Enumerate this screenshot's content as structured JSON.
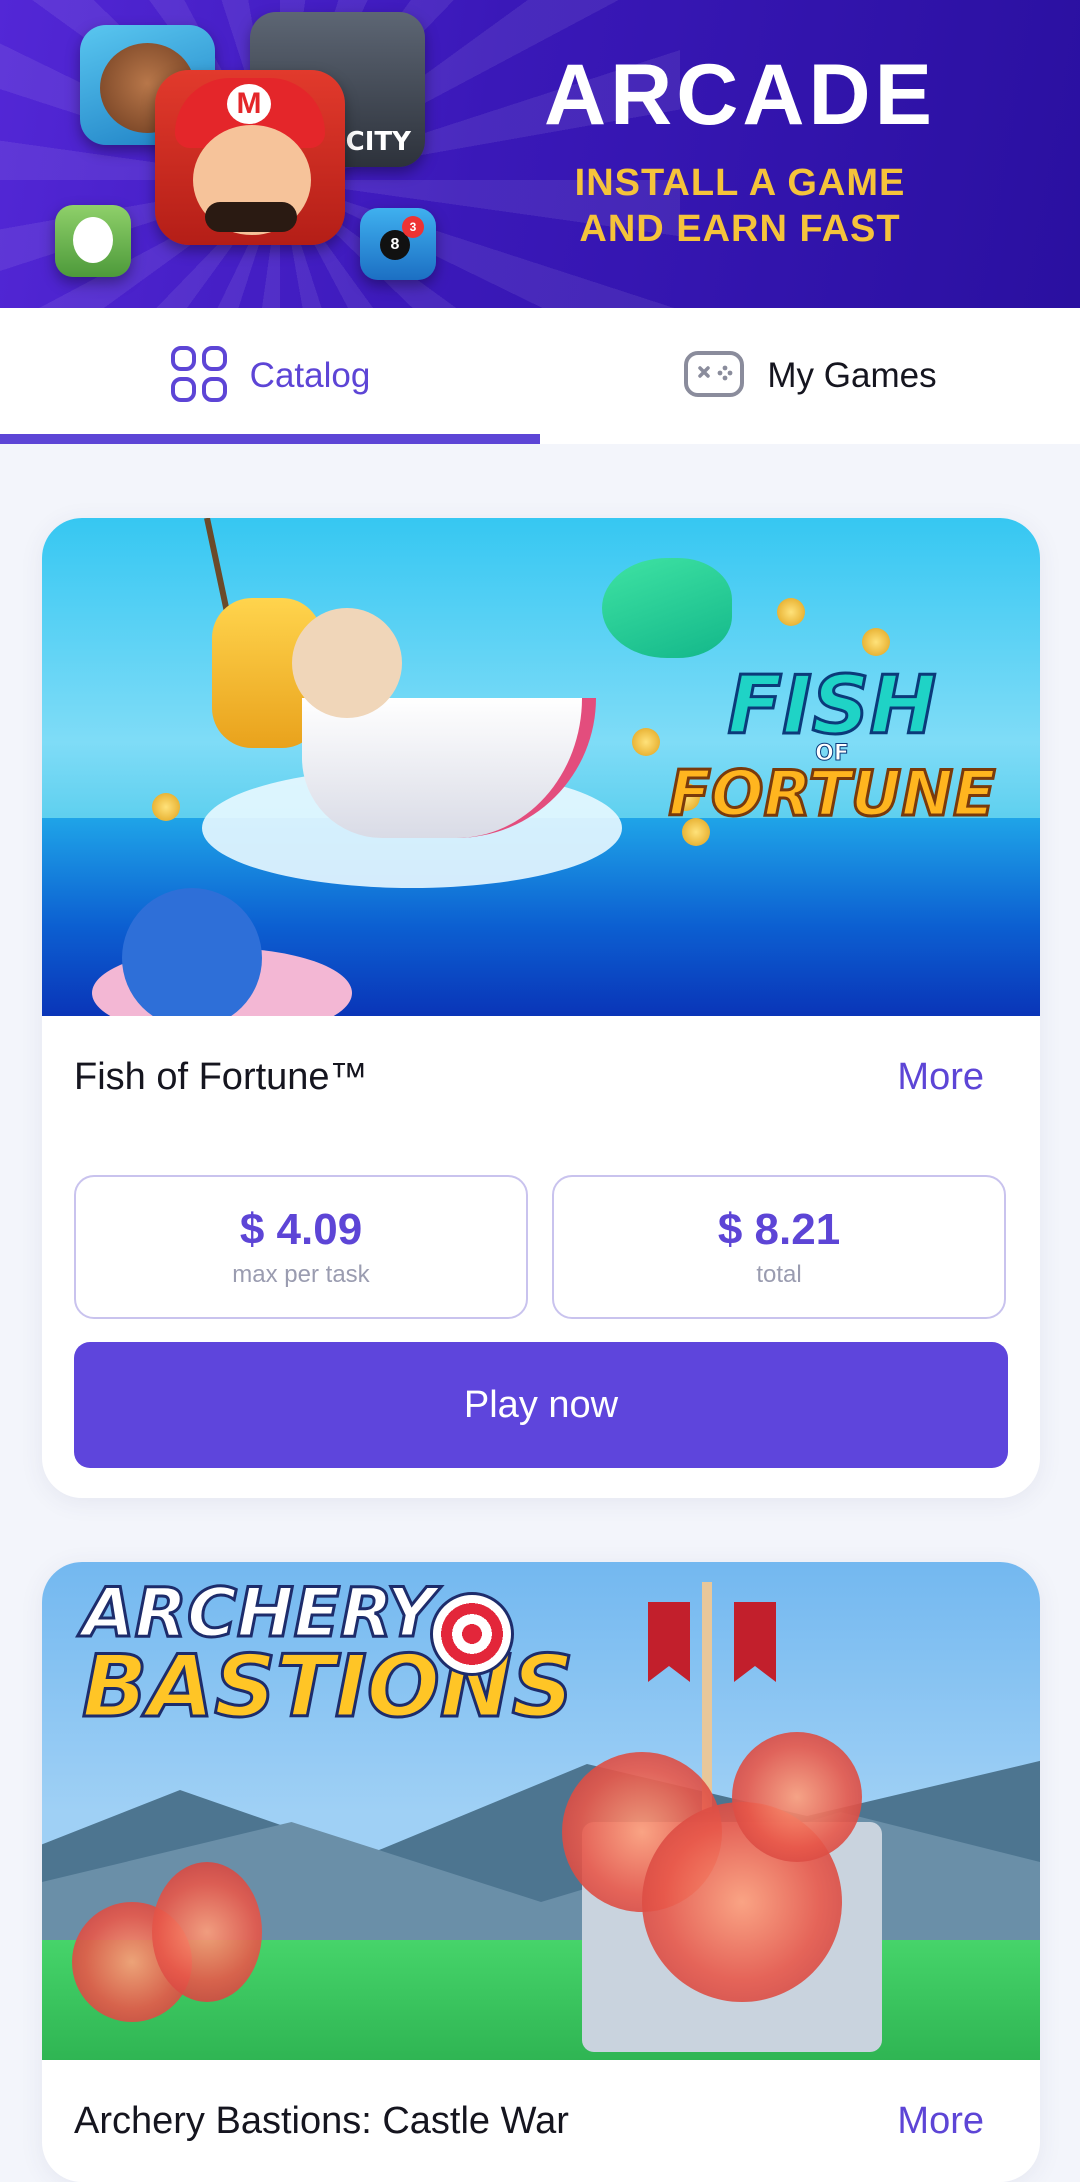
{
  "banner": {
    "title": "ARCADE",
    "subtitle_line1": "INSTALL A GAME",
    "subtitle_line2": "AND EARN FAST"
  },
  "tabs": [
    {
      "label": "Catalog",
      "icon": "grid-icon",
      "active": true
    },
    {
      "label": "My Games",
      "icon": "gamepad-icon",
      "active": false
    }
  ],
  "accent_color": "#5d45d6",
  "games": [
    {
      "title": "Fish of Fortune™",
      "more_label": "More",
      "image_logo": [
        "FISH",
        "OF",
        "FORTUNE"
      ],
      "max_per_task_value": "$ 4.09",
      "max_per_task_label": "max per task",
      "total_value": "$ 8.21",
      "total_label": "total",
      "play_label": "Play now"
    },
    {
      "title": "Archery Bastions: Castle War",
      "more_label": "More",
      "image_logo": [
        "ARCHERY",
        "BASTIONS"
      ]
    }
  ]
}
